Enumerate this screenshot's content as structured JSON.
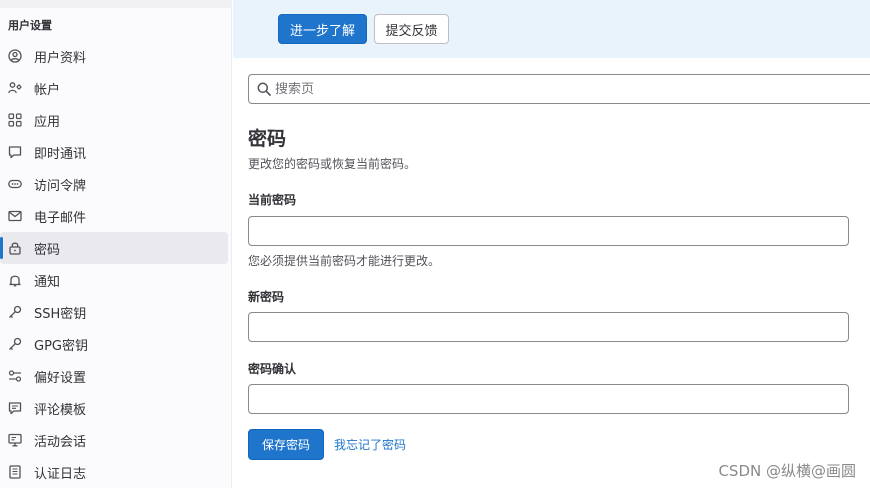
{
  "sidebar": {
    "title": "用户设置",
    "items": [
      {
        "label": "用户资料",
        "icon": "user-circle-icon"
      },
      {
        "label": "帐户",
        "icon": "account-icon"
      },
      {
        "label": "应用",
        "icon": "applications-icon"
      },
      {
        "label": "即时通讯",
        "icon": "chat-icon"
      },
      {
        "label": "访问令牌",
        "icon": "token-icon"
      },
      {
        "label": "电子邮件",
        "icon": "mail-icon"
      },
      {
        "label": "密码",
        "icon": "lock-icon",
        "active": true
      },
      {
        "label": "通知",
        "icon": "bell-icon"
      },
      {
        "label": "SSH密钥",
        "icon": "key-icon"
      },
      {
        "label": "GPG密钥",
        "icon": "key-icon"
      },
      {
        "label": "偏好设置",
        "icon": "preferences-icon"
      },
      {
        "label": "评论模板",
        "icon": "comment-template-icon"
      },
      {
        "label": "活动会话",
        "icon": "monitor-icon"
      },
      {
        "label": "认证日志",
        "icon": "log-icon"
      }
    ]
  },
  "banner": {
    "learn_more": "进一步了解",
    "feedback": "提交反馈"
  },
  "search": {
    "placeholder": "搜索页"
  },
  "main": {
    "title": "密码",
    "description": "更改您的密码或恢复当前密码。",
    "current_password_label": "当前密码",
    "current_password_help": "您必须提供当前密码才能进行更改。",
    "new_password_label": "新密码",
    "confirm_password_label": "密码确认",
    "save_button": "保存密码",
    "forgot_link": "我忘记了密码"
  },
  "watermark": "CSDN @纵横@画圆",
  "colors": {
    "accent": "#1f75cb",
    "banner_bg": "#e9f3fc",
    "sidebar_bg": "#fbfafd",
    "active_item_bg": "#e9e9ee"
  }
}
